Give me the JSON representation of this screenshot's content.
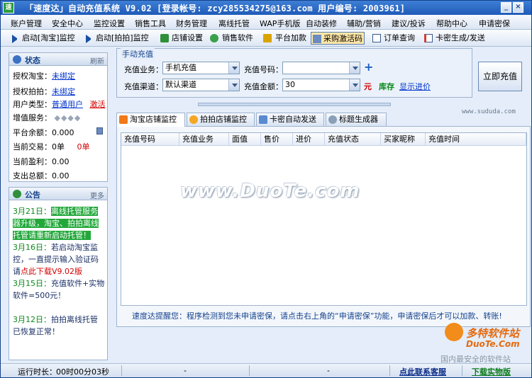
{
  "window": {
    "title": "「速度达」自动充值系统 V9.02 [登录帐号: zcy285534275@163.com 用户编号: 2003961]",
    "app_icon_text": "速"
  },
  "menu": [
    "账户管理",
    "安全中心",
    "监控设置",
    "销售工具",
    "财务管理",
    "离线托管",
    "WAP手机版",
    "自动装修",
    "辅助/营销",
    "建议/投诉",
    "帮助中心",
    "申请密保"
  ],
  "toolbar": {
    "start_taobao": "启动[淘宝]监控",
    "start_paipai": "启动[拍拍]监控",
    "shop_settings": "店铺设置",
    "sell_software": "销售软件",
    "platform_join": "平台加款",
    "purchase_code": "采购激活码",
    "order_query": "订单查询",
    "card_generate": "卡密生成/发送"
  },
  "status_panel": {
    "title": "状态",
    "refresh": "刷新",
    "auth_taobao_label": "授权淘宝：",
    "auth_taobao_value": "未绑定",
    "auth_paipai_label": "授权拍拍：",
    "auth_paipai_value": "未绑定",
    "user_type_label": "用户类型：",
    "user_type_value": "普通用户",
    "activate": "激活",
    "vas_label": "增值服务：",
    "balance_label": "平台余额：",
    "balance_value": "0.000",
    "trade_label": "当前交易：",
    "trade_value": "0单",
    "trade_value2": "0单",
    "profit_label": "当前盈利：",
    "profit_value": "0.00",
    "expense_label": "支出总额：",
    "expense_value": "0.00"
  },
  "notice_panel": {
    "title": "公告",
    "more": "更多",
    "items": [
      {
        "date": "3月21日：",
        "text": "离线托管服务器升级，淘宝、拍拍离线托管请重新启动托管！"
      },
      {
        "date": "3月16日：",
        "text_a": "若启动淘宝监控，一直提示输入验证码请",
        "text_b": "点此下载V9.02版"
      },
      {
        "date": "3月15日：",
        "text": "充值软件+实物软件=500元！"
      },
      {
        "date": "3月12日：",
        "text": "拍拍离线托管已恢复正常！"
      }
    ]
  },
  "manual_recharge": {
    "group_title": "手动充值",
    "business_label": "充值业务：",
    "business_value": "手机充值",
    "number_label": "充值号码：",
    "number_value": "",
    "channel_label": "充值渠道：",
    "channel_value": "默认渠道",
    "amount_label": "充值金额：",
    "amount_value": "30",
    "currency": "元",
    "stock": "库存",
    "show_cost": "显示进价",
    "recharge_button": "立即充值"
  },
  "site_url": "www.sududa.com",
  "tabs": [
    "淘宝店铺监控",
    "拍拍店铺监控",
    "卡密自动发送",
    "标题生成器"
  ],
  "table": {
    "columns": [
      "充值号码",
      "充值业务",
      "面值",
      "售价",
      "进价",
      "充值状态",
      "买家昵称",
      "充值时间"
    ]
  },
  "watermark": "www.DuoTe.com",
  "reminder": "速度达提醒您：程序检测到您未申请密保，请点击右上角的“申请密保”功能，申请密保后才可以加款、转账!",
  "badge": {
    "name": "多特软件站",
    "url": "DuoTe.Com",
    "slogan": "国内最安全的软件站"
  },
  "status_bar": {
    "runtime_label": "运行时长：",
    "runtime_value": "00时00分03秒",
    "dash1": "-",
    "dash2": "-",
    "contact": "点此联系客服",
    "download": "下载实物版"
  },
  "colors": {
    "title_bar": "#2a66c4",
    "accent_green": "#22a83a",
    "link_blue": "#0033cc",
    "alert_red": "#d40000"
  }
}
